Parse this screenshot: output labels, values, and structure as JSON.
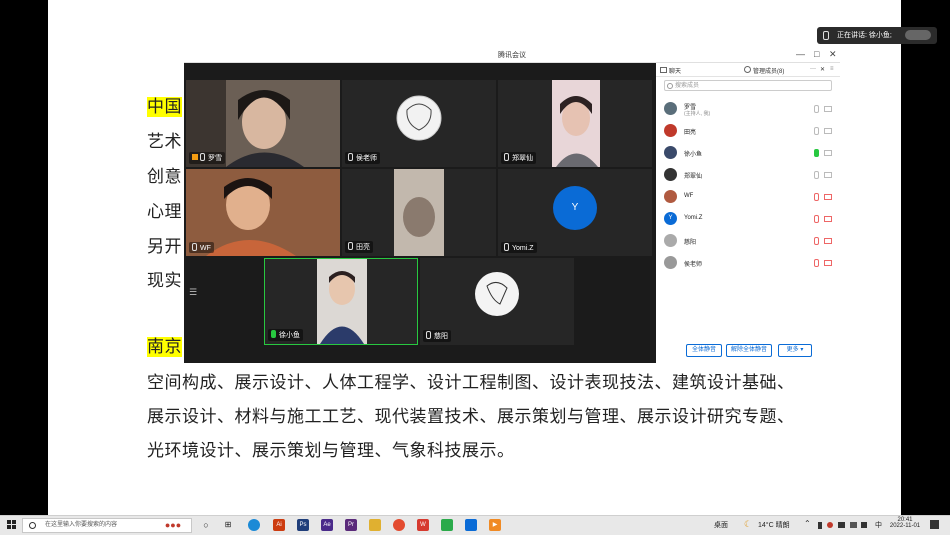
{
  "document": {
    "lines": [
      {
        "text": "中国",
        "highlight": true
      },
      {
        "text": "艺术",
        "highlight": false
      },
      {
        "text": "创意",
        "highlight": false
      },
      {
        "text": "心理",
        "highlight": false
      },
      {
        "text": "另开",
        "highlight": false
      },
      {
        "text": "现实",
        "highlight": false
      },
      {
        "text": "南京",
        "highlight": true
      },
      {
        "text": "空间构成、展示设计、人体工程学、设计工程制图、设计表现技法、建筑设计基础、",
        "highlight": false
      },
      {
        "text": "展示设计、材料与施工工艺、现代装置技术、展示策划与管理、展示设计研究专题、",
        "highlight": false
      },
      {
        "text": "光环境设计、展示策划与管理、气象科技展示。",
        "highlight": false
      }
    ]
  },
  "speaking_indicator": {
    "text": "正在讲话: 徐小鱼;"
  },
  "meeting": {
    "title": "腾讯会议",
    "videos": [
      {
        "name": "罗雪",
        "avatar_letter": "",
        "host": true
      },
      {
        "name": "侯老师",
        "avatar_letter": ""
      },
      {
        "name": "郑翠仙",
        "avatar_letter": ""
      },
      {
        "name": "WF",
        "avatar_letter": ""
      },
      {
        "name": "田亮",
        "avatar_letter": ""
      },
      {
        "name": "Yomi.Z",
        "avatar_letter": "Y"
      },
      {
        "name": "徐小鱼",
        "avatar_letter": "",
        "speaking": true
      },
      {
        "name": "慈阳",
        "avatar_letter": ""
      }
    ],
    "panel": {
      "tab_chat": "聊天",
      "tab_members": "管理成员(8)",
      "search_placeholder": "搜索成员",
      "members": [
        {
          "name": "罗雪",
          "sub": "(主持人, 我)",
          "mic": "idle",
          "cam": "idle",
          "avatar_color": "#5a6e7a"
        },
        {
          "name": "田亮",
          "sub": "",
          "mic": "idle",
          "cam": "idle",
          "avatar_color": "#c0392b"
        },
        {
          "name": "徐小鱼",
          "sub": "",
          "mic": "on",
          "cam": "idle",
          "avatar_color": "#3a4a6a"
        },
        {
          "name": "郑翠仙",
          "sub": "",
          "mic": "idle",
          "cam": "idle",
          "avatar_color": "#333333"
        },
        {
          "name": "WF",
          "sub": "",
          "mic": "off",
          "cam": "off",
          "avatar_color": "#b05a40"
        },
        {
          "name": "Yomi.Z",
          "sub": "",
          "mic": "off",
          "cam": "off",
          "avatar_color": "#0a6bd6",
          "letter": "Y"
        },
        {
          "name": "慈阳",
          "sub": "",
          "mic": "off",
          "cam": "off",
          "avatar_color": "#aaaaaa"
        },
        {
          "name": "侯老师",
          "sub": "",
          "mic": "off",
          "cam": "off",
          "avatar_color": "#999999"
        }
      ],
      "btn_mute_all": "全体静音",
      "btn_unmute_all": "解除全体静音",
      "btn_more": "更多 ▾"
    }
  },
  "taskbar": {
    "search_placeholder": "在这里输入你要搜索的内容",
    "desktop": "桌面",
    "weather": "14°C 晴朗",
    "ime": "中",
    "time": "20:41",
    "date": "2022-11-01",
    "colors": {
      "accent": "#0a6bd6",
      "highlight": "#ffff00"
    }
  }
}
